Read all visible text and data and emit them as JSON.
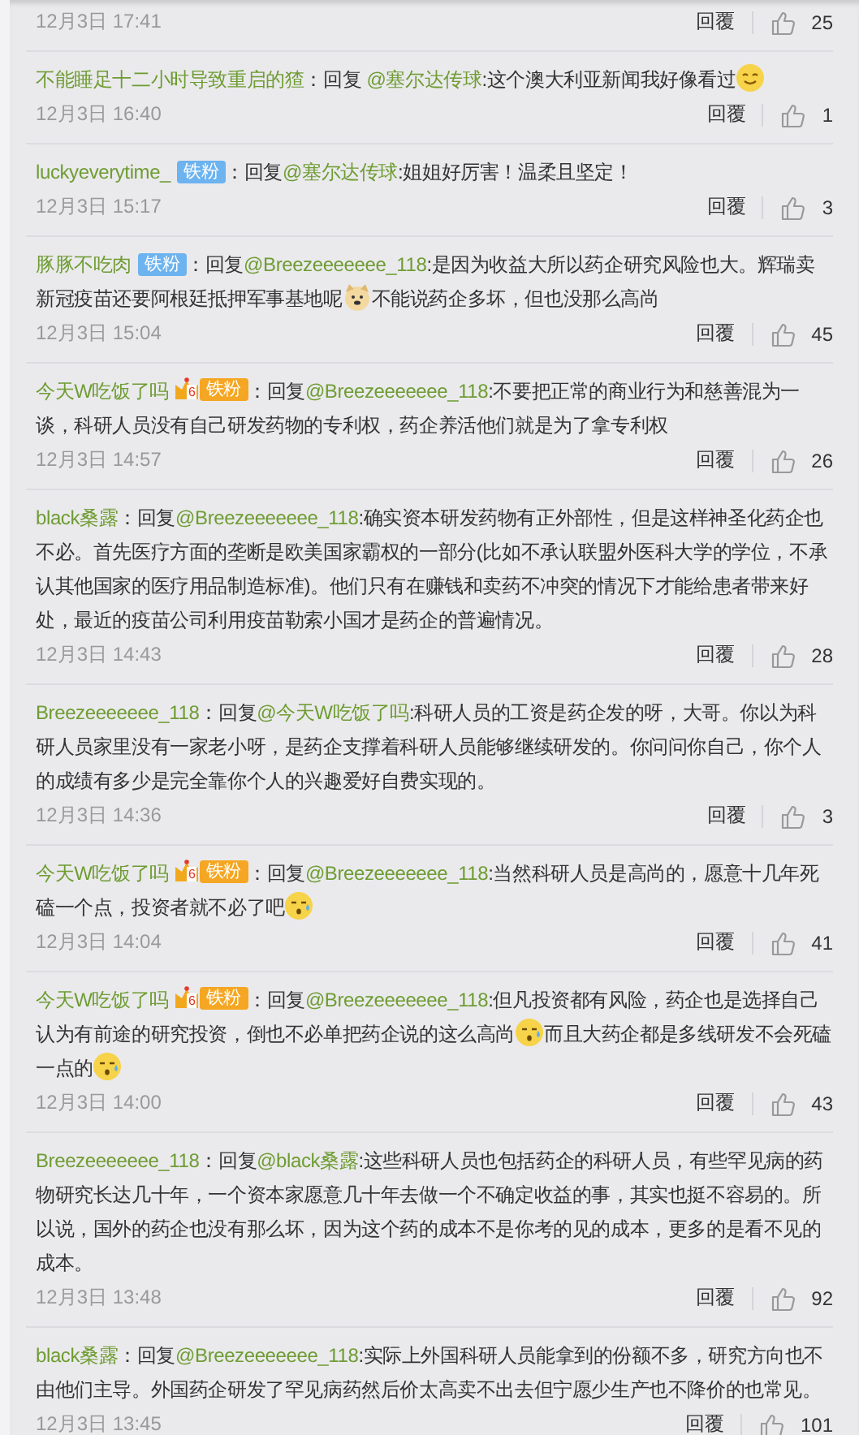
{
  "comments": [
    {
      "time": "12月3日 17:41",
      "reply": "回覆",
      "likes": "25"
    },
    {
      "user": "不能睡足十二小时导致重启的猹",
      "segments": [
        {
          "kind": "text",
          "text": "：回复 "
        },
        {
          "kind": "mention",
          "text": "@塞尔达传球"
        },
        {
          "kind": "text",
          "text": ":这个澳大利亚新闻我好像看过"
        },
        {
          "kind": "smile"
        }
      ],
      "time": "12月3日 16:40",
      "reply": "回覆",
      "likes": "1"
    },
    {
      "user": "luckyeverytime_",
      "badge": {
        "kind": "blue",
        "label": "铁粉"
      },
      "segments": [
        {
          "kind": "text",
          "text": "：回复"
        },
        {
          "kind": "mention",
          "text": "@塞尔达传球"
        },
        {
          "kind": "text",
          "text": ":姐姐好厉害！温柔且坚定！"
        }
      ],
      "time": "12月3日 15:17",
      "reply": "回覆",
      "likes": "3"
    },
    {
      "user": "豚豚不吃肉",
      "badge": {
        "kind": "blue",
        "label": "铁粉"
      },
      "segments": [
        {
          "kind": "text",
          "text": "：回复"
        },
        {
          "kind": "mention",
          "text": "@Breezeeeeeee_118"
        },
        {
          "kind": "text",
          "text": ":是因为收益大所以药企研究风险也大。辉瑞卖新冠疫苗还要阿根廷抵押军事基地呢"
        },
        {
          "kind": "dog"
        },
        {
          "kind": "text",
          "text": "不能说药企多坏，但也没那么高尚"
        }
      ],
      "time": "12月3日 15:04",
      "reply": "回覆",
      "likes": "45"
    },
    {
      "user": "今天W吃饭了吗",
      "badge": {
        "kind": "gold",
        "level": "6",
        "label": "铁粉"
      },
      "segments": [
        {
          "kind": "text",
          "text": "：回复"
        },
        {
          "kind": "mention",
          "text": "@Breezeeeeeee_118"
        },
        {
          "kind": "text",
          "text": ":不要把正常的商业行为和慈善混为一谈，科研人员没有自己研发药物的专利权，药企养活他们就是为了拿专利权"
        }
      ],
      "time": "12月3日 14:57",
      "reply": "回覆",
      "likes": "26"
    },
    {
      "user": "black桑露",
      "segments": [
        {
          "kind": "text",
          "text": "：回复"
        },
        {
          "kind": "mention",
          "text": "@Breezeeeeeee_118"
        },
        {
          "kind": "text",
          "text": ":确实资本研发药物有正外部性，但是这样神圣化药企也不必。首先医疗方面的垄断是欧美国家霸权的一部分(比如不承认联盟外医科大学的学位，不承认其他国家的医疗用品制造标准)。他们只有在赚钱和卖药不冲突的情况下才能给患者带来好处，最近的疫苗公司利用疫苗勒索小国才是药企的普遍情况。"
        }
      ],
      "time": "12月3日 14:43",
      "reply": "回覆",
      "likes": "28"
    },
    {
      "user": "Breezeeeeeee_118",
      "segments": [
        {
          "kind": "text",
          "text": "：回复"
        },
        {
          "kind": "mention",
          "text": "@今天W吃饭了吗"
        },
        {
          "kind": "text",
          "text": ":科研人员的工资是药企发的呀，大哥。你以为科研人员家里没有一家老小呀，是药企支撑着科研人员能够继续研发的。你问问你自己，你个人的成绩有多少是完全靠你个人的兴趣爱好自费实现的。"
        }
      ],
      "time": "12月3日 14:36",
      "reply": "回覆",
      "likes": "3"
    },
    {
      "user": "今天W吃饭了吗",
      "badge": {
        "kind": "gold",
        "level": "6",
        "label": "铁粉"
      },
      "segments": [
        {
          "kind": "text",
          "text": "：回复"
        },
        {
          "kind": "mention",
          "text": "@Breezeeeeeee_118"
        },
        {
          "kind": "text",
          "text": ":当然科研人员是高尚的，愿意十几年死磕一个点，投资者就不必了吧"
        },
        {
          "kind": "sweat"
        }
      ],
      "time": "12月3日 14:04",
      "reply": "回覆",
      "likes": "41"
    },
    {
      "user": "今天W吃饭了吗",
      "badge": {
        "kind": "gold",
        "level": "6",
        "label": "铁粉"
      },
      "segments": [
        {
          "kind": "text",
          "text": "：回复"
        },
        {
          "kind": "mention",
          "text": "@Breezeeeeeee_118"
        },
        {
          "kind": "text",
          "text": ":但凡投资都有风险，药企也是选择自己认为有前途的研究投资，倒也不必单把药企说的这么高尚"
        },
        {
          "kind": "sweat"
        },
        {
          "kind": "text",
          "text": "而且大药企都是多线研发不会死磕一点的"
        },
        {
          "kind": "sweat"
        }
      ],
      "time": "12月3日 14:00",
      "reply": "回覆",
      "likes": "43"
    },
    {
      "user": "Breezeeeeeee_118",
      "segments": [
        {
          "kind": "text",
          "text": "：回复"
        },
        {
          "kind": "mention",
          "text": "@black桑露"
        },
        {
          "kind": "text",
          "text": ":这些科研人员也包括药企的科研人员，有些罕见病的药物研究长达几十年，一个资本家愿意几十年去做一个不确定收益的事，其实也挺不容易的。所以说，国外的药企也没有那么坏，因为这个药的成本不是你考的见的成本，更多的是看不见的成本。"
        }
      ],
      "time": "12月3日 13:48",
      "reply": "回覆",
      "likes": "92"
    },
    {
      "user": "black桑露",
      "segments": [
        {
          "kind": "text",
          "text": "：回复"
        },
        {
          "kind": "mention",
          "text": "@Breezeeeeeee_118"
        },
        {
          "kind": "text",
          "text": ":实际上外国科研人员能拿到的份额不多，研究方向也不由他们主导。外国药企研发了罕见病药然后价太高卖不出去但宁愿少生产也不降价的也常见。"
        }
      ],
      "time": "12月3日 13:45",
      "reply": "回覆",
      "likes": "101"
    }
  ]
}
